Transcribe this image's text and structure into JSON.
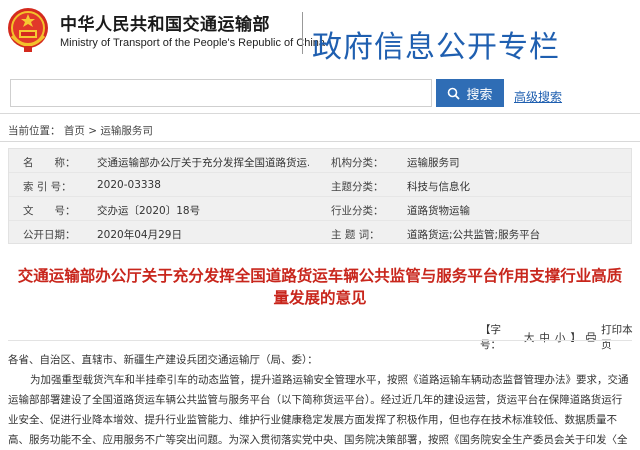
{
  "header": {
    "org_cn": "中华人民共和国交通运输部",
    "org_en": "Ministry of Transport of the People's Republic of China",
    "portal_title": "政府信息公开专栏",
    "emblem_icon": "national-emblem-icon",
    "title_color": "#1f5fb0"
  },
  "search": {
    "value": "",
    "placeholder": "",
    "button_label": "搜索",
    "advanced_label": "高级搜索"
  },
  "breadcrumb": {
    "prefix": "当前位置：",
    "home": "首页",
    "separator": ">",
    "section": "运输服务司"
  },
  "meta": {
    "name_label": "名　　称：",
    "name_value": "交通运输部办公厅关于充分发挥全国道路货运...",
    "agency_label": "机构分类：",
    "agency_value": "运输服务司",
    "index_label": "索 引 号：",
    "index_value": "2020-03338",
    "topic_label": "主题分类：",
    "topic_value": "科技与信息化",
    "docno_label": "文　　号：",
    "docno_value": "交办运〔2020〕18号",
    "industry_label": "行业分类：",
    "industry_value": "道路货物运输",
    "date_label": "公开日期：",
    "date_value": "2020年04月29日",
    "keywords_label": "主 题 词：",
    "keywords_value": "道路货运;公共监管;服务平台"
  },
  "document": {
    "title": "交通运输部办公厅关于充分发挥全国道路货运车辆公共监管与服务平台作用支撑行业高质量发展的意见",
    "title_color": "#c8261c"
  },
  "toolbar": {
    "font_label": "【字号：",
    "size_large": "大",
    "size_medium": "中",
    "size_small": "小",
    "font_close": "】",
    "print_icon": "printer-icon",
    "print_label": "打印本页"
  },
  "body": {
    "salutation": "各省、自治区、直辖市、新疆生产建设兵团交通运输厅（局、委）：",
    "paragraph1": "为加强重型载货汽车和半挂牵引车的动态监管，提升道路运输安全管理水平，按照《道路运输车辆动态监督管理办法》要求，交通运输部部署建设了全国道路货运车辆公共监管与服务平台（以下简称货运平台）。经过近几年的建设运营，货运平台在保障道路货运行业安全、促进行业降本增效、提升行业监管能力、维护行业健康稳定发展方面发挥了积极作用，但也存在技术标准较低、数据质量不高、服务功能不全、应用服务不广等突出问题。为深入贯彻落实党中央、国务院决策部署，按照《国务院安全生产委员会关于印发〈全国安全生产"
  }
}
